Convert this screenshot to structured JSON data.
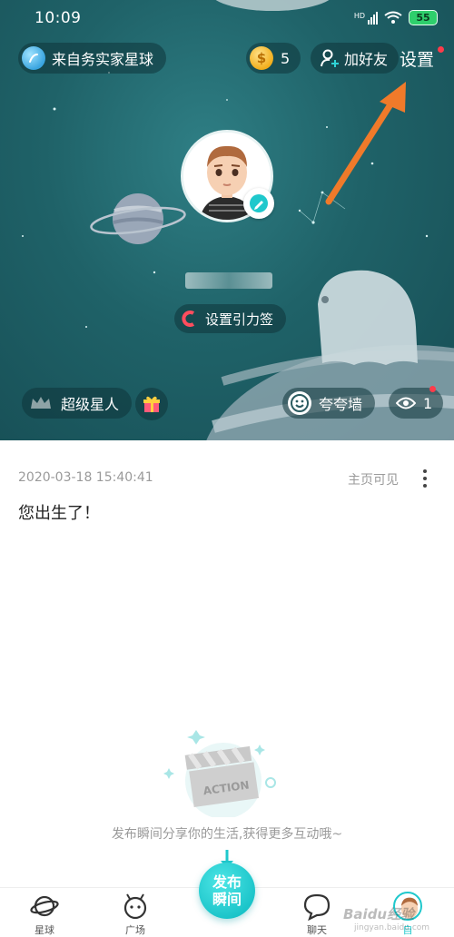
{
  "status_bar": {
    "time": "10:09",
    "signal_label": "HD",
    "battery": "55"
  },
  "header": {
    "origin_label": "来自务实家星球",
    "coins": "5",
    "add_friend_label": "加好友",
    "settings_label": "设置"
  },
  "profile": {
    "gravity_tag_label": "设置引力签"
  },
  "actions": {
    "super_star_label": "超级星人",
    "praise_wall_label": "夸夸墙",
    "views_count": "1"
  },
  "post": {
    "date": "2020-03-18 15:40:41",
    "visibility": "主页可见",
    "content": "您出生了！"
  },
  "empty_state": {
    "clapper_text": "ACTION",
    "hint": "发布瞬间分享你的生活,获得更多互动哦~"
  },
  "tabbar": {
    "planet_label": "星球",
    "square_label": "广场",
    "publish_label_line1": "发布",
    "publish_label_line2": "瞬间",
    "chat_label": "聊天",
    "me_label": "自"
  },
  "watermark": {
    "brand": "Baidu经验",
    "domain": "jingyan.baidu.com"
  },
  "colors": {
    "accent": "#1fc8cc",
    "hero_bg": "#1f6268",
    "notification": "#ff3b4a",
    "arrow": "#f07a2a"
  }
}
